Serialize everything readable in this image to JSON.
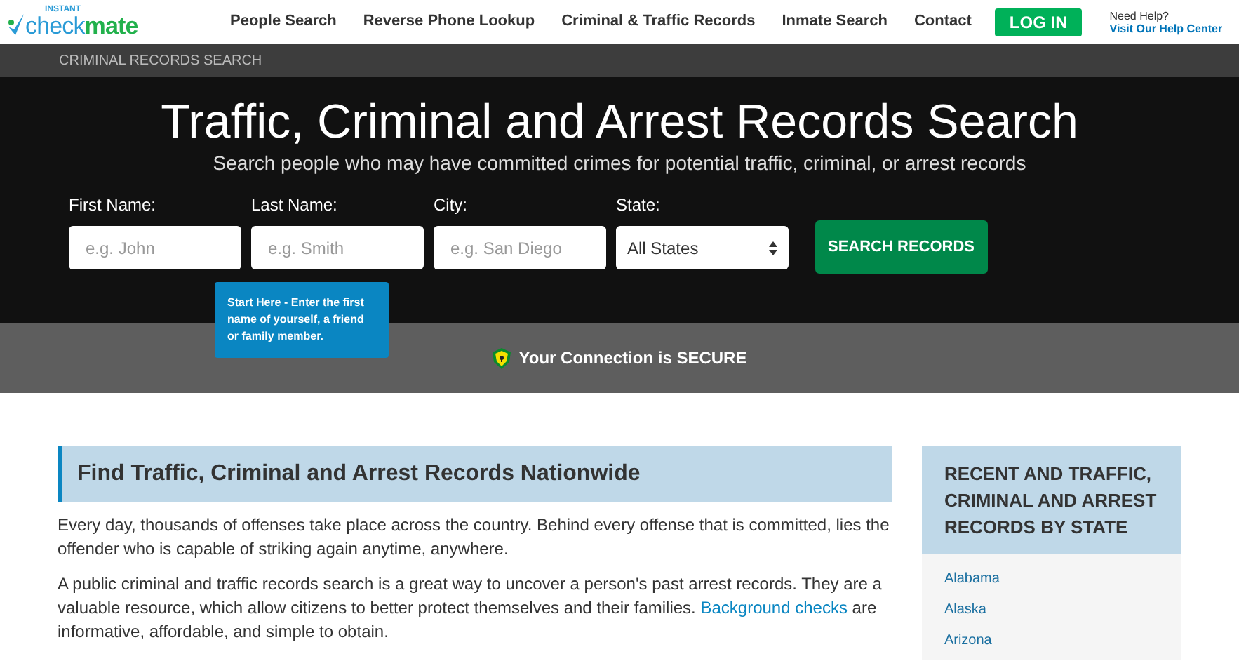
{
  "logo": {
    "small": "INSTANT",
    "part_1": "check",
    "part_2": "mate"
  },
  "nav": [
    "People Search",
    "Reverse Phone Lookup",
    "Criminal & Traffic Records",
    "Inmate Search",
    "Contact"
  ],
  "login_button": "LOG IN",
  "help": {
    "question": "Need Help?",
    "link": "Visit Our Help Center"
  },
  "breadcrumb": "CRIMINAL RECORDS SEARCH",
  "hero": {
    "title": "Traffic, Criminal and Arrest Records Search",
    "subtitle": "Search people who may have committed crimes for potential traffic, criminal, or arrest records"
  },
  "form": {
    "fields": [
      {
        "kind": "text",
        "label": "First Name:",
        "placeholder": "e.g. John"
      },
      {
        "kind": "text",
        "label": "Last Name:",
        "placeholder": "e.g. Smith"
      },
      {
        "kind": "text",
        "label": "City:",
        "placeholder": "e.g. San Diego"
      },
      {
        "kind": "select",
        "label": "State:",
        "value": "All States"
      }
    ],
    "submit": "SEARCH RECORDS",
    "tooltip": "Start Here - Enter the first name of yourself, a friend or family member."
  },
  "secure_notice": "Your Connection is SECURE",
  "article": {
    "heading": "Find Traffic, Criminal and Arrest Records Nationwide",
    "paragraphs": [
      {
        "text": "Every day, thousands of offenses take place across the country. Behind every offense that is committed, lies the offender who is capable of striking again anytime, anywhere."
      },
      {
        "text": "A public criminal and traffic records search is a great way to uncover a person's past arrest records. They are a valuable resource, which allow citizens to better protect themselves and their families. ",
        "link": "Background checks",
        "text_after": " are informative, affordable, and simple to obtain."
      }
    ]
  },
  "sidebar": {
    "heading": "RECENT AND TRAFFIC, CRIMINAL AND ARREST RECORDS BY STATE",
    "states": [
      "Alabama",
      "Alaska",
      "Arizona"
    ]
  }
}
